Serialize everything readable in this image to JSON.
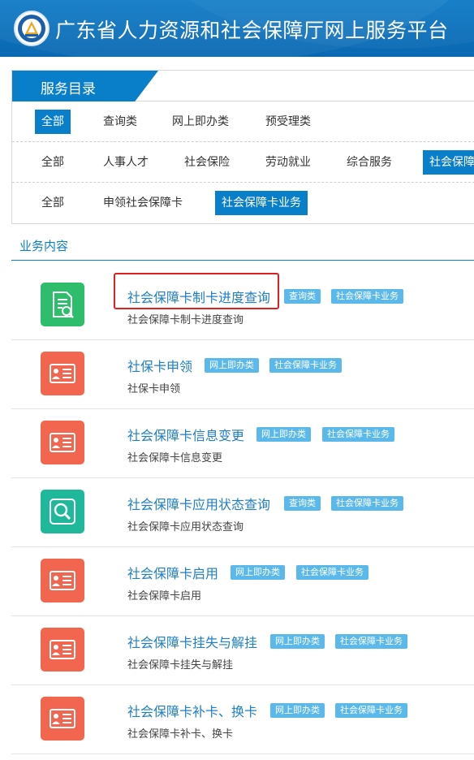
{
  "header": {
    "title": "广东省人力资源和社会保障厅网上服务平台"
  },
  "catalog": {
    "heading": "服务目录",
    "row1": [
      "全部",
      "查询类",
      "网上即办类",
      "预受理类"
    ],
    "row2": [
      "全部",
      "人事人才",
      "社会保险",
      "劳动就业",
      "综合服务",
      "社会保障"
    ],
    "row3": [
      "全部",
      "申领社会保障卡",
      "社会保障卡业务"
    ]
  },
  "section": {
    "title": "业务内容"
  },
  "items": [
    {
      "title": "社会保障卡制卡进度查询",
      "desc": "社会保障卡制卡进度查询",
      "tag1": "查询类",
      "tag2": "社会保障卡业务",
      "icon": "document-search-icon",
      "color": "#2ebd6b"
    },
    {
      "title": "社保卡申领",
      "desc": "社保卡申领",
      "tag1": "网上即办类",
      "tag2": "社会保障卡业务",
      "icon": "id-card-icon",
      "color": "#f2664f"
    },
    {
      "title": "社会保障卡信息变更",
      "desc": "社会保障卡信息变更",
      "tag1": "网上即办类",
      "tag2": "社会保障卡业务",
      "icon": "id-card-icon",
      "color": "#f2664f"
    },
    {
      "title": "社会保障卡应用状态查询",
      "desc": "社会保障卡应用状态查询",
      "tag1": "查询类",
      "tag2": "社会保障卡业务",
      "icon": "magnifier-icon",
      "color": "#1fb89a"
    },
    {
      "title": "社会保障卡启用",
      "desc": "社会保障卡启用",
      "tag1": "网上即办类",
      "tag2": "社会保障卡业务",
      "icon": "id-card-icon",
      "color": "#f2664f"
    },
    {
      "title": "社会保障卡挂失与解挂",
      "desc": "社会保障卡挂失与解挂",
      "tag1": "网上即办类",
      "tag2": "社会保障卡业务",
      "icon": "id-card-icon",
      "color": "#f2664f"
    },
    {
      "title": "社会保障卡补卡、换卡",
      "desc": "社会保障卡补卡、换卡",
      "tag1": "网上即办类",
      "tag2": "社会保障卡业务",
      "icon": "id-card-icon",
      "color": "#f2664f"
    }
  ]
}
